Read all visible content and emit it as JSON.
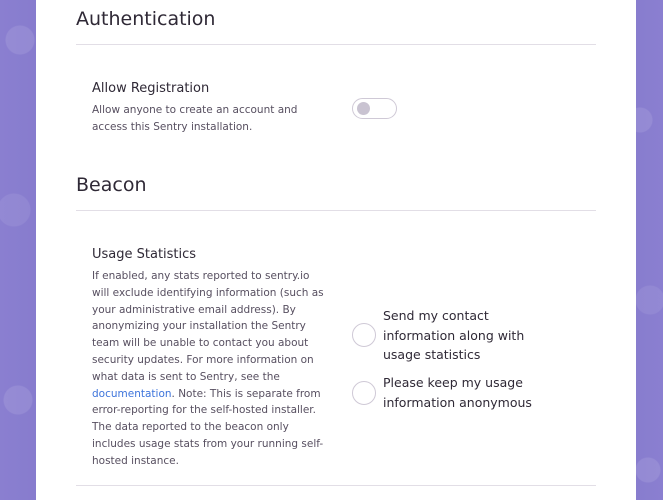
{
  "authentication": {
    "title": "Authentication",
    "allow_registration": {
      "label": "Allow Registration",
      "help": "Allow anyone to create an account and access this Sentry installation.",
      "enabled": false
    }
  },
  "beacon": {
    "title": "Beacon",
    "usage_statistics": {
      "label": "Usage Statistics",
      "help_before": "If enabled, any stats reported to sentry.io will exclude identifying information (such as your administrative email address). By anonymizing your installation the Sentry team will be unable to contact you about security updates. For more information on what data is sent to Sentry, see the ",
      "help_link": "documentation",
      "help_after": ". Note: This is separate from error-reporting for the self-hosted installer. The data reported to the beacon only includes usage stats from your running self-hosted instance.",
      "options": [
        {
          "label": "Send my contact information along with usage statistics",
          "selected": false
        },
        {
          "label": "Please keep my usage information anonymous",
          "selected": false
        }
      ]
    }
  }
}
